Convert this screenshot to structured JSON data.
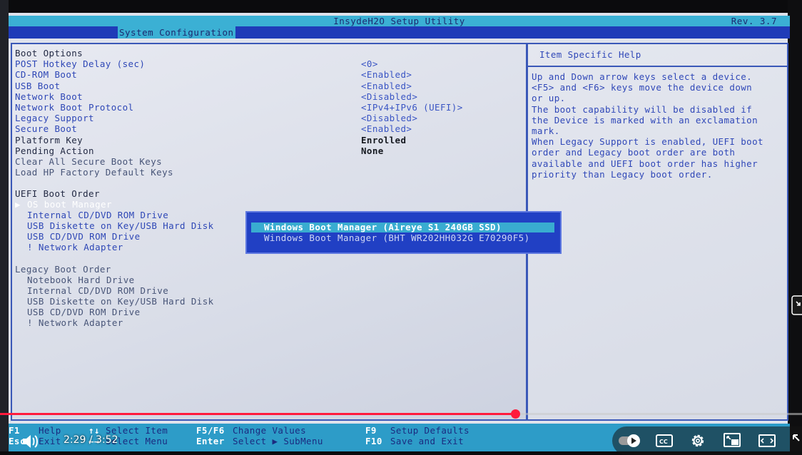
{
  "app": {
    "title": "InsydeH2O Setup Utility",
    "revision": "Rev. 3.7",
    "active_tab": "System Configuration"
  },
  "boot_options": [
    {
      "label": "Boot Options",
      "type": "header"
    },
    {
      "label": "POST Hotkey Delay (sec)",
      "value": "<0>"
    },
    {
      "label": "CD-ROM Boot",
      "value": "<Enabled>"
    },
    {
      "label": "USB Boot",
      "value": "<Enabled>"
    },
    {
      "label": "Network Boot",
      "value": "<Disabled>"
    },
    {
      "label": "Network Boot Protocol",
      "value": "<IPv4+IPv6 (UEFI)>"
    },
    {
      "label": "Legacy Support",
      "value": "<Disabled>"
    },
    {
      "label": "Secure Boot",
      "value": "<Enabled>"
    },
    {
      "label": "Platform Key",
      "value": "Enrolled",
      "type": "static"
    },
    {
      "label": "Pending Action",
      "value": "None",
      "type": "static"
    },
    {
      "label": "Clear All Secure Boot Keys",
      "type": "dim"
    },
    {
      "label": "Load HP Factory Default Keys",
      "type": "dim"
    }
  ],
  "uefi_boot_order": {
    "title": "UEFI Boot Order",
    "selected_marker": "▶",
    "items": [
      "OS boot Manager",
      "Internal CD/DVD ROM Drive",
      "USB Diskette on Key/USB Hard Disk",
      "USB CD/DVD ROM Drive",
      "! Network Adapter"
    ]
  },
  "legacy_boot_order": {
    "title": "Legacy Boot Order",
    "items": [
      "Notebook Hard Drive",
      "Internal CD/DVD ROM Drive",
      "USB Diskette on Key/USB Hard Disk",
      "USB CD/DVD ROM Drive",
      "! Network Adapter"
    ]
  },
  "popup": {
    "items": [
      "Windows Boot Manager (Aireye S1 240GB SSD)",
      "Windows Boot Manager (BHT WR202HH032G E70290F5)"
    ]
  },
  "help": {
    "title": "Item Specific Help",
    "lines": [
      "Up and Down arrow keys select a device.",
      "<F5> and <F6> keys move the device down",
      "or up.",
      "The boot capability will be disabled if",
      "the Device is marked with an exclamation",
      "mark.",
      "When Legacy Support is enabled, UEFI boot",
      "order and Legacy boot order are both",
      "available and UEFI boot order has higher",
      "priority than Legacy boot order."
    ]
  },
  "footer": {
    "f1_key": "F1",
    "f1_desc": "Help",
    "esc_key": "Esc",
    "esc_desc": "Exit",
    "arrows_ud": "↑↓",
    "arrows_ud_desc": "Select Item",
    "arrows_lr": "←→",
    "arrows_lr_desc": "Select Menu",
    "f5f6_key": "F5/F6",
    "f5f6_desc": "Change Values",
    "enter_key": "Enter",
    "enter_desc": "Select ▶ SubMenu",
    "f9_key": "F9",
    "f9_desc": "Setup Defaults",
    "f10_key": "F10",
    "f10_desc": "Save and Exit"
  },
  "video": {
    "current_time": "2:29",
    "duration": "3:52",
    "time_text": "2:29 / 3:52",
    "progress_fraction": 0.642,
    "accent_color": "#ff1a3c"
  }
}
